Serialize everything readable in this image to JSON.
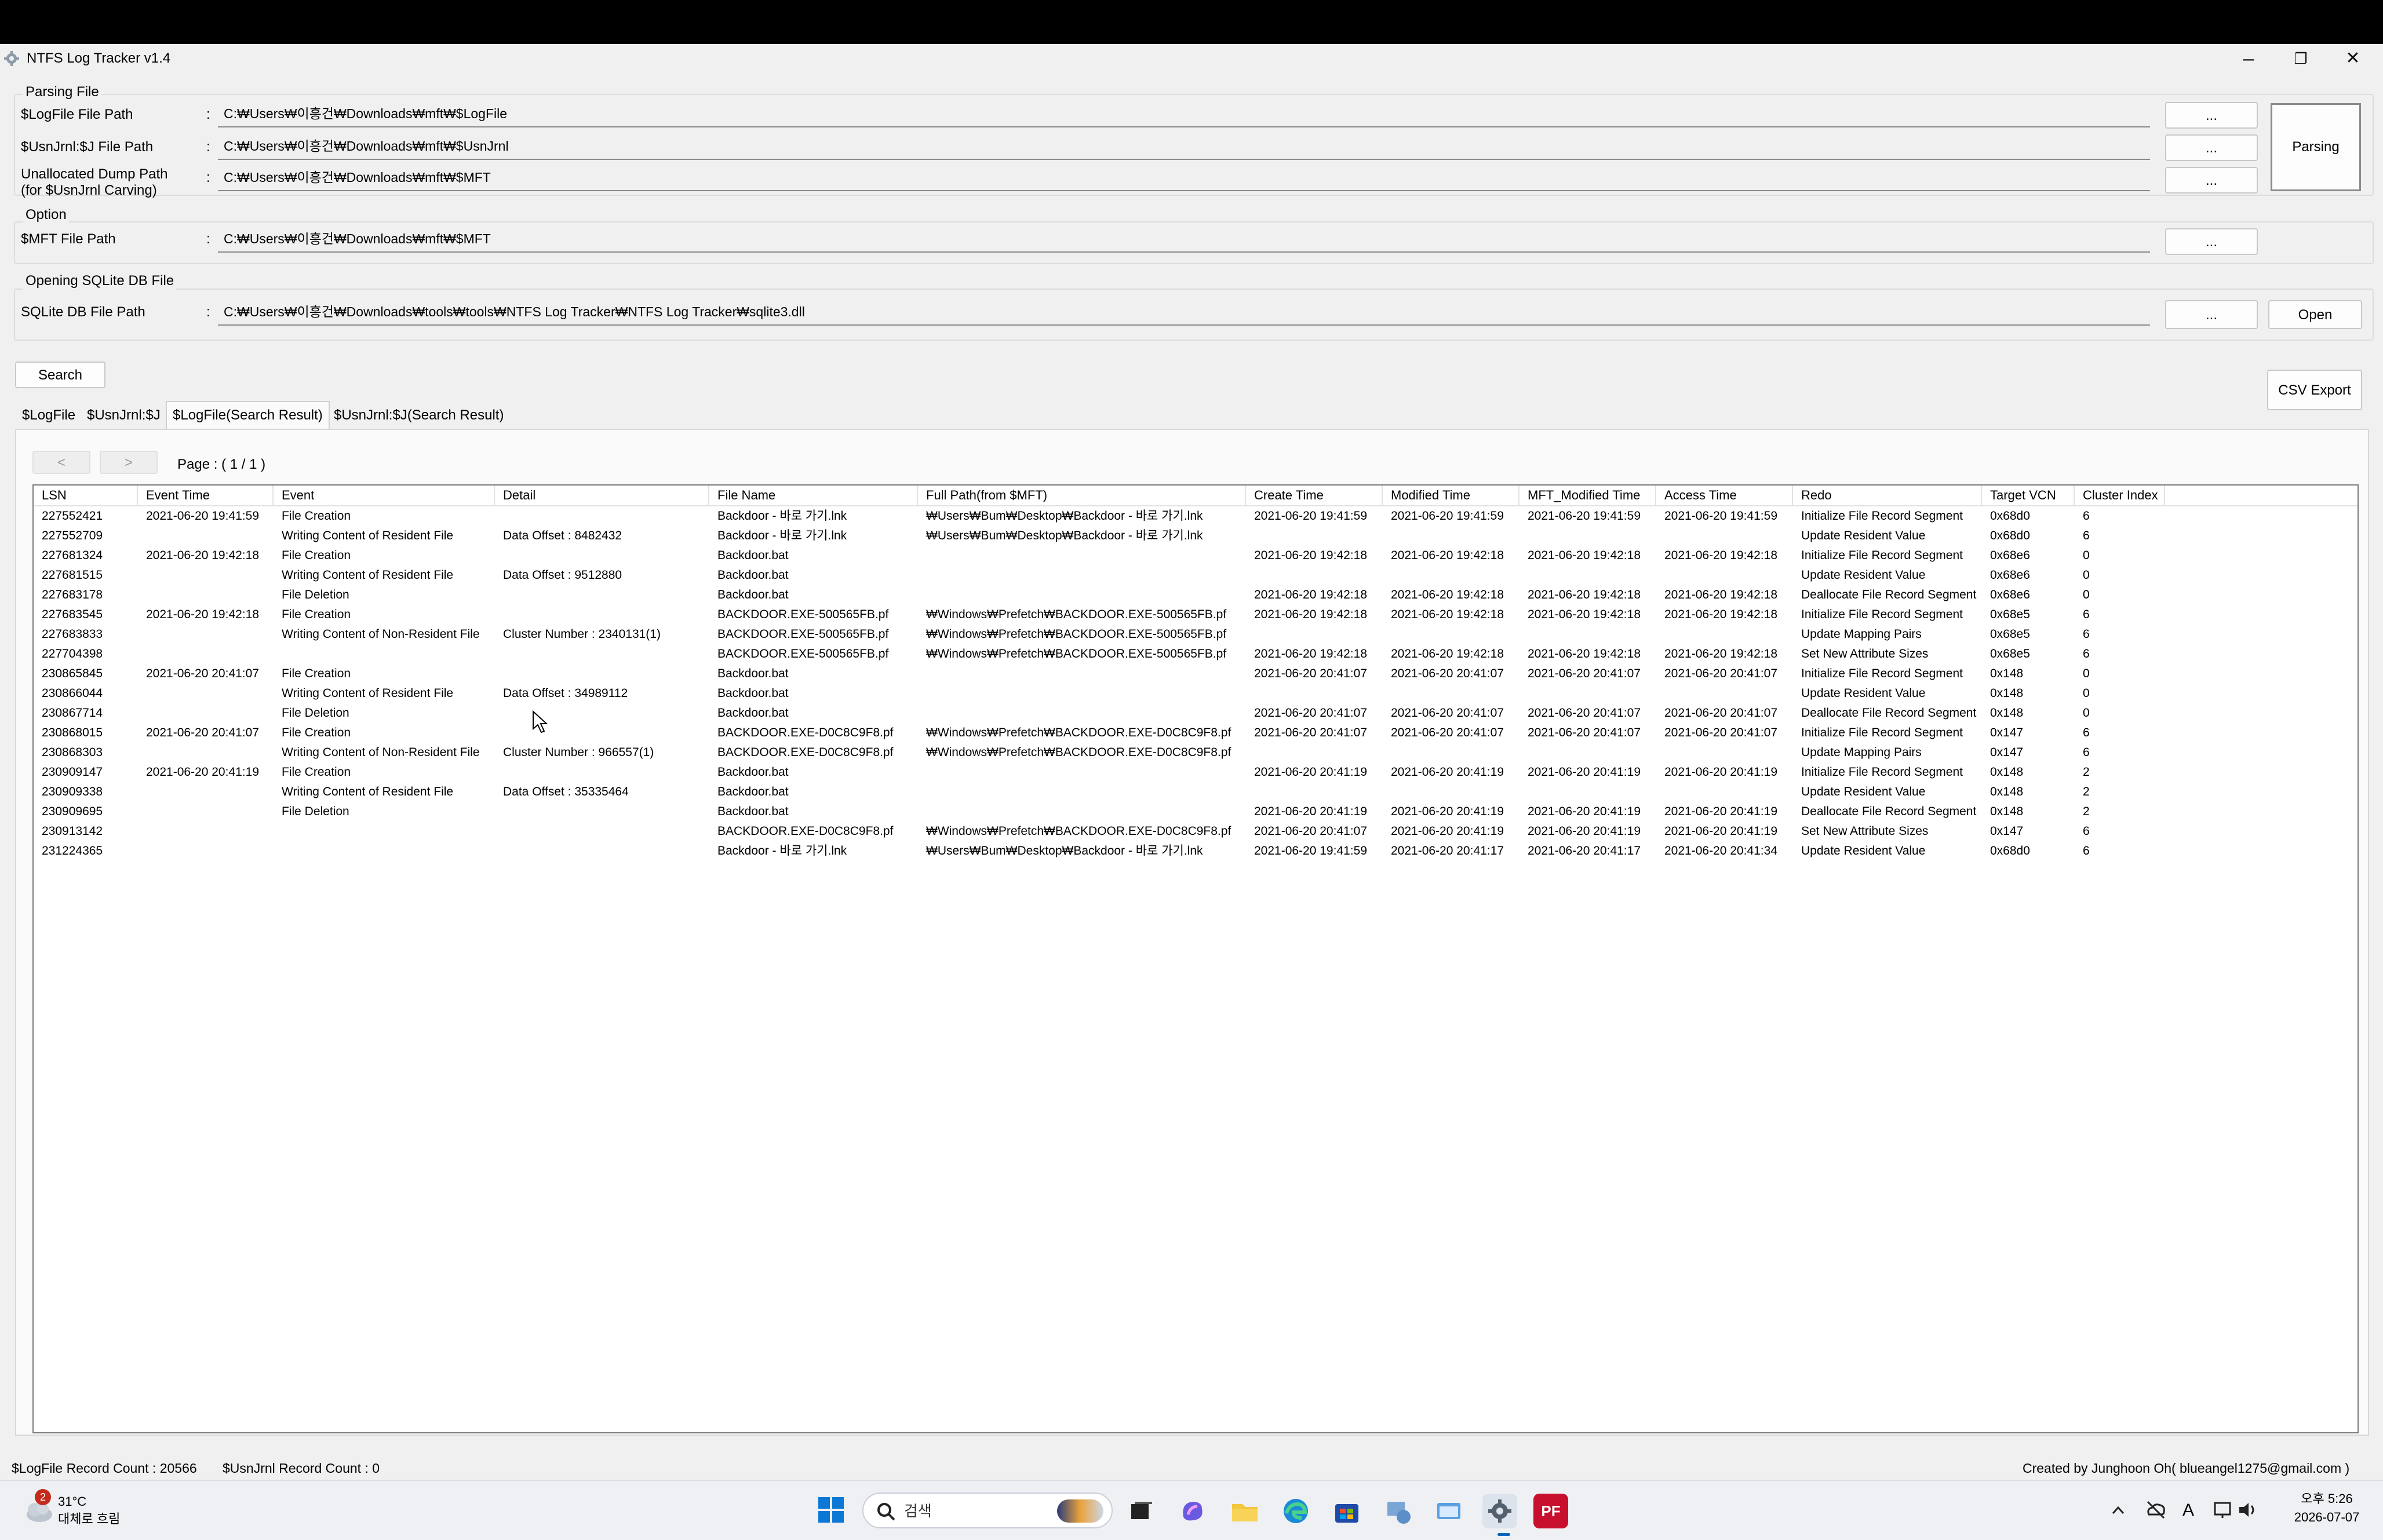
{
  "window": {
    "title": "NTFS Log Tracker v1.4",
    "min_glyph": "–",
    "max_glyph": "❐",
    "close_glyph": "✕"
  },
  "parsing": {
    "group_label": "Parsing File",
    "logfile_label": "$LogFile File Path",
    "logfile_path": "C:₩Users₩이흥건₩Downloads₩mft₩$LogFile",
    "usnjrnl_label": "$UsnJrnl:$J File Path",
    "usnjrnl_path": "C:₩Users₩이흥건₩Downloads₩mft₩$UsnJrnl",
    "unalloc_label_1": "Unallocated Dump Path",
    "unalloc_label_2": "(for $UsnJrnl Carving)",
    "unalloc_path": "C:₩Users₩이흥건₩Downloads₩mft₩$MFT",
    "browse_label": "...",
    "parsing_button": "Parsing"
  },
  "option": {
    "group_label": "Option",
    "mft_label": "$MFT File Path",
    "mft_path": "C:₩Users₩이흥건₩Downloads₩mft₩$MFT"
  },
  "sqlite": {
    "group_label": "Opening SQLite DB File",
    "label": "SQLite DB File Path",
    "path": "C:₩Users₩이흥건₩Downloads₩tools₩tools₩NTFS Log Tracker₩NTFS Log Tracker₩sqlite3.dll",
    "open_button": "Open"
  },
  "colon": ":",
  "search_button": "Search",
  "csv_export_button": "CSV Export",
  "tabs": [
    "$LogFile",
    "$UsnJrnl:$J",
    "$LogFile(Search Result)",
    "$UsnJrnl:$J(Search Result)"
  ],
  "pager": {
    "prev": "<",
    "next": ">",
    "page_text": "Page : ( 1 / 1 )"
  },
  "table": {
    "columns": [
      "LSN",
      "Event Time",
      "Event",
      "Detail",
      "File Name",
      "Full Path(from $MFT)",
      "Create Time",
      "Modified Time",
      "MFT_Modified Time",
      "Access Time",
      "Redo",
      "Target VCN",
      "Cluster Index"
    ],
    "rows": [
      [
        "227552421",
        "2021-06-20 19:41:59",
        "File Creation",
        "",
        "Backdoor - 바로 가기.lnk",
        "₩Users₩Bum₩Desktop₩Backdoor - 바로 가기.lnk",
        "2021-06-20 19:41:59",
        "2021-06-20 19:41:59",
        "2021-06-20 19:41:59",
        "2021-06-20 19:41:59",
        "Initialize File Record Segment",
        "0x68d0",
        "6"
      ],
      [
        "227552709",
        "",
        "Writing Content of Resident File",
        "Data Offset : 8482432",
        "Backdoor - 바로 가기.lnk",
        "₩Users₩Bum₩Desktop₩Backdoor - 바로 가기.lnk",
        "",
        "",
        "",
        "",
        "Update Resident Value",
        "0x68d0",
        "6"
      ],
      [
        "227681324",
        "2021-06-20 19:42:18",
        "File Creation",
        "",
        "Backdoor.bat",
        "",
        "2021-06-20 19:42:18",
        "2021-06-20 19:42:18",
        "2021-06-20 19:42:18",
        "2021-06-20 19:42:18",
        "Initialize File Record Segment",
        "0x68e6",
        "0"
      ],
      [
        "227681515",
        "",
        "Writing Content of Resident File",
        "Data Offset : 9512880",
        "Backdoor.bat",
        "",
        "",
        "",
        "",
        "",
        "Update Resident Value",
        "0x68e6",
        "0"
      ],
      [
        "227683178",
        "",
        "File Deletion",
        "",
        "Backdoor.bat",
        "",
        "2021-06-20 19:42:18",
        "2021-06-20 19:42:18",
        "2021-06-20 19:42:18",
        "2021-06-20 19:42:18",
        "Deallocate File Record Segment",
        "0x68e6",
        "0"
      ],
      [
        "227683545",
        "2021-06-20 19:42:18",
        "File Creation",
        "",
        "BACKDOOR.EXE-500565FB.pf",
        "₩Windows₩Prefetch₩BACKDOOR.EXE-500565FB.pf",
        "2021-06-20 19:42:18",
        "2021-06-20 19:42:18",
        "2021-06-20 19:42:18",
        "2021-06-20 19:42:18",
        "Initialize File Record Segment",
        "0x68e5",
        "6"
      ],
      [
        "227683833",
        "",
        "Writing Content of Non-Resident File",
        "Cluster Number : 2340131(1)",
        "BACKDOOR.EXE-500565FB.pf",
        "₩Windows₩Prefetch₩BACKDOOR.EXE-500565FB.pf",
        "",
        "",
        "",
        "",
        "Update Mapping Pairs",
        "0x68e5",
        "6"
      ],
      [
        "227704398",
        "",
        "",
        "",
        "BACKDOOR.EXE-500565FB.pf",
        "₩Windows₩Prefetch₩BACKDOOR.EXE-500565FB.pf",
        "2021-06-20 19:42:18",
        "2021-06-20 19:42:18",
        "2021-06-20 19:42:18",
        "2021-06-20 19:42:18",
        "Set New Attribute Sizes",
        "0x68e5",
        "6"
      ],
      [
        "230865845",
        "2021-06-20 20:41:07",
        "File Creation",
        "",
        "Backdoor.bat",
        "",
        "2021-06-20 20:41:07",
        "2021-06-20 20:41:07",
        "2021-06-20 20:41:07",
        "2021-06-20 20:41:07",
        "Initialize File Record Segment",
        "0x148",
        "0"
      ],
      [
        "230866044",
        "",
        "Writing Content of Resident File",
        "Data Offset : 34989112",
        "Backdoor.bat",
        "",
        "",
        "",
        "",
        "",
        "Update Resident Value",
        "0x148",
        "0"
      ],
      [
        "230867714",
        "",
        "File Deletion",
        "",
        "Backdoor.bat",
        "",
        "2021-06-20 20:41:07",
        "2021-06-20 20:41:07",
        "2021-06-20 20:41:07",
        "2021-06-20 20:41:07",
        "Deallocate File Record Segment",
        "0x148",
        "0"
      ],
      [
        "230868015",
        "2021-06-20 20:41:07",
        "File Creation",
        "",
        "BACKDOOR.EXE-D0C8C9F8.pf",
        "₩Windows₩Prefetch₩BACKDOOR.EXE-D0C8C9F8.pf",
        "2021-06-20 20:41:07",
        "2021-06-20 20:41:07",
        "2021-06-20 20:41:07",
        "2021-06-20 20:41:07",
        "Initialize File Record Segment",
        "0x147",
        "6"
      ],
      [
        "230868303",
        "",
        "Writing Content of Non-Resident File",
        "Cluster Number : 966557(1)",
        "BACKDOOR.EXE-D0C8C9F8.pf",
        "₩Windows₩Prefetch₩BACKDOOR.EXE-D0C8C9F8.pf",
        "",
        "",
        "",
        "",
        "Update Mapping Pairs",
        "0x147",
        "6"
      ],
      [
        "230909147",
        "2021-06-20 20:41:19",
        "File Creation",
        "",
        "Backdoor.bat",
        "",
        "2021-06-20 20:41:19",
        "2021-06-20 20:41:19",
        "2021-06-20 20:41:19",
        "2021-06-20 20:41:19",
        "Initialize File Record Segment",
        "0x148",
        "2"
      ],
      [
        "230909338",
        "",
        "Writing Content of Resident File",
        "Data Offset : 35335464",
        "Backdoor.bat",
        "",
        "",
        "",
        "",
        "",
        "Update Resident Value",
        "0x148",
        "2"
      ],
      [
        "230909695",
        "",
        "File Deletion",
        "",
        "Backdoor.bat",
        "",
        "2021-06-20 20:41:19",
        "2021-06-20 20:41:19",
        "2021-06-20 20:41:19",
        "2021-06-20 20:41:19",
        "Deallocate File Record Segment",
        "0x148",
        "2"
      ],
      [
        "230913142",
        "",
        "",
        "",
        "BACKDOOR.EXE-D0C8C9F8.pf",
        "₩Windows₩Prefetch₩BACKDOOR.EXE-D0C8C9F8.pf",
        "2021-06-20 20:41:07",
        "2021-06-20 20:41:19",
        "2021-06-20 20:41:19",
        "2021-06-20 20:41:19",
        "Set New Attribute Sizes",
        "0x147",
        "6"
      ],
      [
        "231224365",
        "",
        "",
        "",
        "Backdoor - 바로 가기.lnk",
        "₩Users₩Bum₩Desktop₩Backdoor - 바로 가기.lnk",
        "2021-06-20 19:41:59",
        "2021-06-20 20:41:17",
        "2021-06-20 20:41:17",
        "2021-06-20 20:41:34",
        "Update Resident Value",
        "0x68d0",
        "6"
      ]
    ]
  },
  "status": {
    "logfile_count": "$LogFile Record Count : 20566",
    "usnjrnl_count": "$UsnJrnl Record Count : 0",
    "credit": "Created by Junghoon Oh( blueangel1275@gmail.com )"
  },
  "taskbar": {
    "weather_badge": "2",
    "temperature": "31°C",
    "weather_text": "대체로 흐림",
    "search_placeholder": "검색",
    "time": "오후 5:26",
    "date": "2026-07-07",
    "pdf_icon_text": "PF",
    "ime_text": "A"
  },
  "colors": {
    "accent": "#0067c0",
    "window_bg": "#f0f0f0",
    "grid_bg": "#ffffff"
  }
}
